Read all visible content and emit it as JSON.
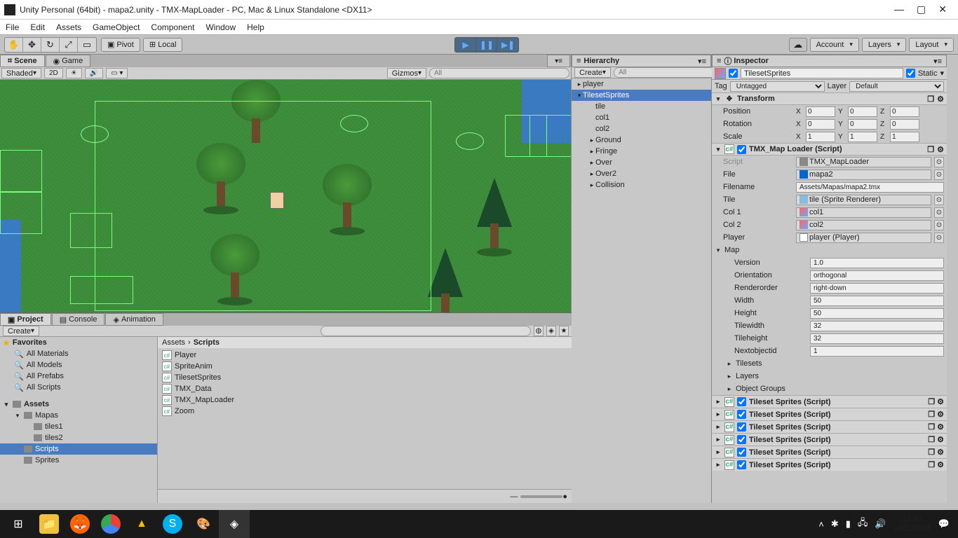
{
  "window": {
    "title": "Unity Personal (64bit) - mapa2.unity - TMX-MapLoader - PC, Mac & Linux Standalone <DX11>"
  },
  "menu": [
    "File",
    "Edit",
    "Assets",
    "GameObject",
    "Component",
    "Window",
    "Help"
  ],
  "toolbar": {
    "pivot": "Pivot",
    "local": "Local",
    "account": "Account",
    "layers": "Layers",
    "layout": "Layout"
  },
  "tabs": {
    "scene": "Scene",
    "game": "Game",
    "hierarchy": "Hierarchy",
    "inspector": "Inspector",
    "project": "Project",
    "console": "Console",
    "animation": "Animation"
  },
  "scene_toolbar": {
    "shaded": "Shaded",
    "mode2d": "2D",
    "gizmos": "Gizmos",
    "search_placeholder": "All"
  },
  "hierarchy": {
    "create": "Create",
    "search_placeholder": "All",
    "items": [
      {
        "label": "player",
        "indent": 0,
        "exp": "▸"
      },
      {
        "label": "TilesetSprites",
        "indent": 0,
        "exp": "▾",
        "selected": true
      },
      {
        "label": "tile",
        "indent": 1,
        "exp": ""
      },
      {
        "label": "col1",
        "indent": 1,
        "exp": ""
      },
      {
        "label": "col2",
        "indent": 1,
        "exp": ""
      },
      {
        "label": "Ground",
        "indent": 1,
        "exp": "▸"
      },
      {
        "label": "Fringe",
        "indent": 1,
        "exp": "▸"
      },
      {
        "label": "Over",
        "indent": 1,
        "exp": "▸"
      },
      {
        "label": "Over2",
        "indent": 1,
        "exp": "▸"
      },
      {
        "label": "Collision",
        "indent": 1,
        "exp": "▸"
      }
    ]
  },
  "inspector": {
    "object_name": "TilesetSprites",
    "static": "Static",
    "tag": "Tag",
    "tag_value": "Untagged",
    "layer": "Layer",
    "layer_value": "Default",
    "transform": {
      "title": "Transform",
      "position": "Position",
      "rotation": "Rotation",
      "scale": "Scale",
      "pos": {
        "x": "0",
        "y": "0",
        "z": "0"
      },
      "rot": {
        "x": "0",
        "y": "0",
        "z": "0"
      },
      "scl": {
        "x": "1",
        "y": "1",
        "z": "1"
      }
    },
    "loader": {
      "title": "TMX_Map Loader (Script)",
      "script": "Script",
      "script_value": "TMX_MapLoader",
      "file": "File",
      "file_value": "mapa2",
      "filename": "Filename",
      "filename_value": "Assets/Mapas/mapa2.tmx",
      "tile": "Tile",
      "tile_value": "tile (Sprite Renderer)",
      "col1": "Col 1",
      "col1_value": "col1",
      "col2": "Col 2",
      "col2_value": "col2",
      "player": "Player",
      "player_value": "player (Player)",
      "map": "Map"
    },
    "map_props": [
      {
        "label": "Version",
        "value": "1.0"
      },
      {
        "label": "Orientation",
        "value": "orthogonal"
      },
      {
        "label": "Renderorder",
        "value": "right-down"
      },
      {
        "label": "Width",
        "value": "50"
      },
      {
        "label": "Height",
        "value": "50"
      },
      {
        "label": "Tilewidth",
        "value": "32"
      },
      {
        "label": "Tileheight",
        "value": "32"
      },
      {
        "label": "Nextobjectid",
        "value": "1"
      }
    ],
    "map_sub": [
      "Tilesets",
      "Layers",
      "Object Groups"
    ],
    "tileset_sprites": "Tileset Sprites (Script)"
  },
  "project": {
    "create": "Create",
    "favorites": "Favorites",
    "fav_items": [
      "All Materials",
      "All Models",
      "All Prefabs",
      "All Scripts"
    ],
    "assets": "Assets",
    "folders": [
      {
        "label": "Mapas",
        "indent": 1,
        "exp": "▾"
      },
      {
        "label": "tiles1",
        "indent": 2,
        "exp": ""
      },
      {
        "label": "tiles2",
        "indent": 2,
        "exp": ""
      },
      {
        "label": "Scripts",
        "indent": 1,
        "exp": "",
        "selected": true
      },
      {
        "label": "Sprites",
        "indent": 1,
        "exp": ""
      }
    ],
    "breadcrumb": [
      "Assets",
      "Scripts"
    ],
    "files": [
      "Player",
      "SpriteAnim",
      "TilesetSprites",
      "TMX_Data",
      "TMX_MapLoader",
      "Zoom"
    ]
  },
  "taskbar": {
    "time": "15:40",
    "date": "14/11/2016"
  }
}
